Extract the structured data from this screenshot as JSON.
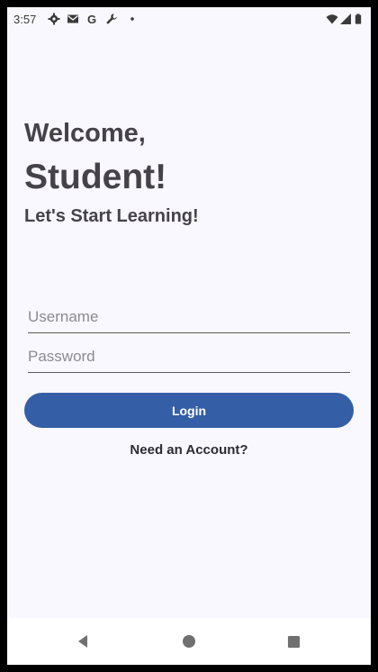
{
  "status_bar": {
    "time": "3:57",
    "icons": [
      "settings-icon",
      "gmail-icon",
      "google-icon",
      "wrench-icon",
      "dot-icon",
      "wifi-icon",
      "signal-icon",
      "battery-icon"
    ]
  },
  "login_screen": {
    "welcome": "Welcome,",
    "student": "Student!",
    "tagline": "Let's Start Learning!",
    "username_placeholder": "Username",
    "password_placeholder": "Password",
    "login_label": "Login",
    "need_account_label": "Need an Account?"
  },
  "colors": {
    "background": "#f9f8fe",
    "heading_text": "#454349",
    "button_fill": "#345ea6",
    "button_text": "#ffffff"
  },
  "nav_bar": {
    "buttons": [
      "back-icon",
      "home-icon",
      "recents-icon"
    ]
  }
}
